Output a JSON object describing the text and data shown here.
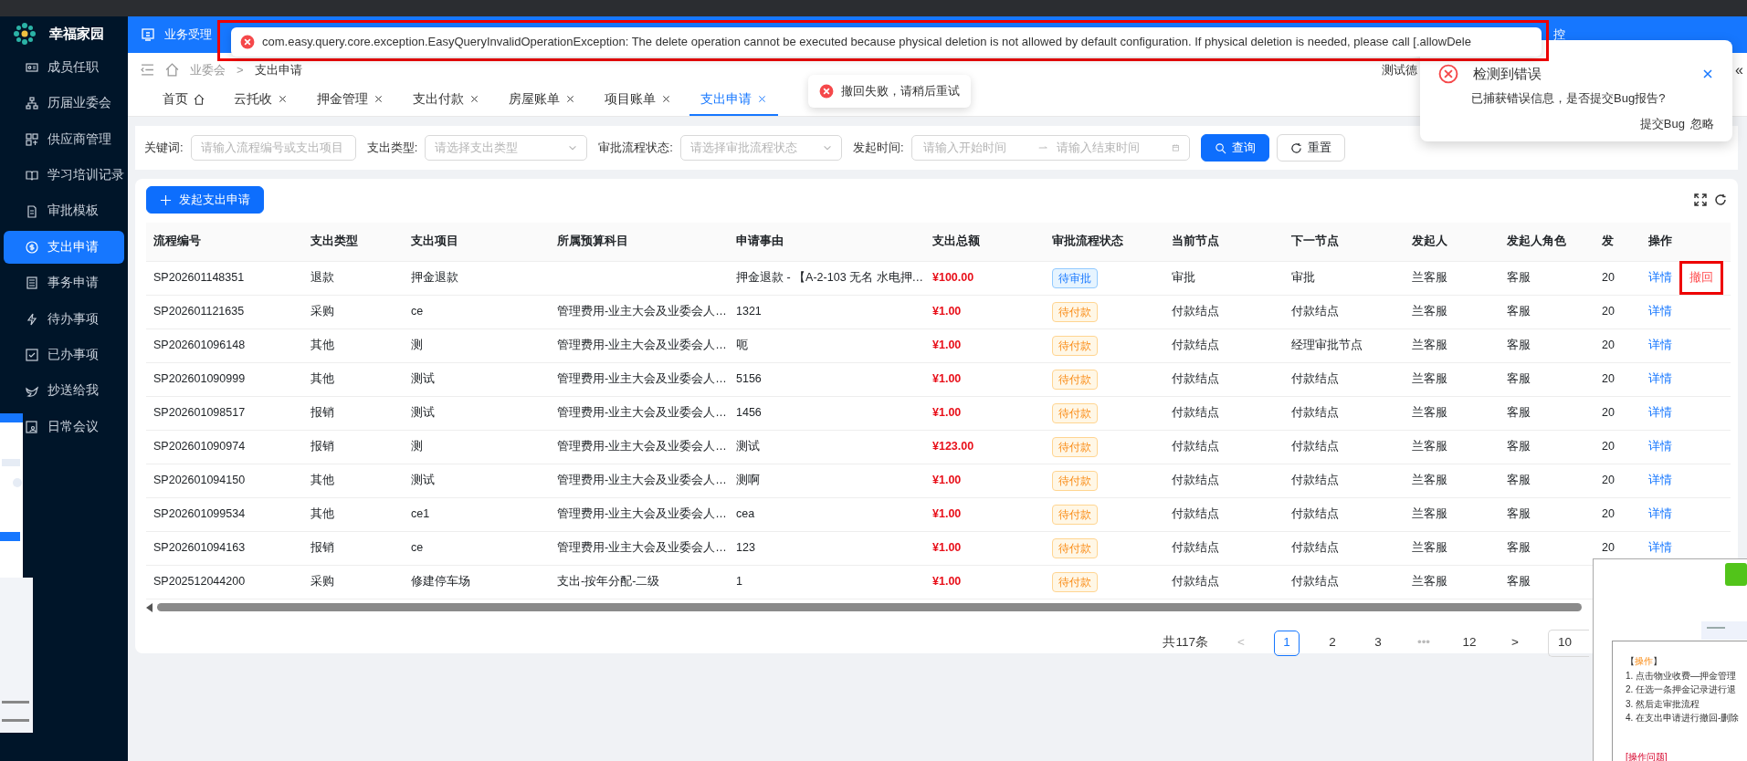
{
  "app": {
    "name": "幸福家园"
  },
  "header": {
    "module": "业务受理",
    "right_text": "控"
  },
  "sidebar": {
    "items": [
      {
        "label": "成员任职",
        "selected": false
      },
      {
        "label": "历届业委会",
        "selected": false
      },
      {
        "label": "供应商管理",
        "selected": false
      },
      {
        "label": "学习培训记录",
        "selected": false
      },
      {
        "label": "审批模板",
        "selected": false
      },
      {
        "label": "支出申请",
        "selected": true
      },
      {
        "label": "事务申请",
        "selected": false
      },
      {
        "label": "待办事项",
        "selected": false
      },
      {
        "label": "已办事项",
        "selected": false
      },
      {
        "label": "抄送给我",
        "selected": false
      },
      {
        "label": "日常会议",
        "selected": false
      }
    ]
  },
  "breadcrumb": {
    "items": [
      "业委会",
      "支出申请"
    ],
    "separator": ">",
    "user_text": "测试德",
    "collapse_glyph": "«"
  },
  "tabs": [
    {
      "label": "首页",
      "kind": "home",
      "selected": false
    },
    {
      "label": "云托收",
      "kind": "closable",
      "selected": false
    },
    {
      "label": "押金管理",
      "kind": "closable",
      "selected": false
    },
    {
      "label": "支出付款",
      "kind": "closable",
      "selected": false
    },
    {
      "label": "房屋账单",
      "kind": "closable",
      "selected": false
    },
    {
      "label": "项目账单",
      "kind": "closable",
      "selected": false
    },
    {
      "label": "支出申请",
      "kind": "closable",
      "selected": true
    }
  ],
  "filters": {
    "keyword": {
      "label": "关键词:",
      "placeholder": "请输入流程编号或支出项目"
    },
    "type": {
      "label": "支出类型:",
      "placeholder": "请选择支出类型"
    },
    "status": {
      "label": "审批流程状态:",
      "placeholder": "请选择审批流程状态"
    },
    "time": {
      "label": "发起时间:",
      "start_placeholder": "请输入开始时间",
      "end_placeholder": "请输入结束时间"
    },
    "search_button": "查询",
    "reset_button": "重置"
  },
  "add_button": "发起支出申请",
  "table": {
    "columns": [
      "流程编号",
      "支出类型",
      "支出项目",
      "所属预算科目",
      "申请事由",
      "支出总额",
      "审批流程状态",
      "当前节点",
      "下一节点",
      "发起人",
      "发起人角色",
      "发",
      "操作"
    ],
    "rows": [
      {
        "number": "SP202601148351",
        "type": "退款",
        "item": "押金退款",
        "reason": "押金退款 - 【A-2-103 无名 水电押…",
        "amount": "¥100.00",
        "status": {
          "text": "待审批",
          "kind": "review"
        },
        "current_node": "审批",
        "next_node": "审批",
        "initiator": "兰客服",
        "role": "客服",
        "column_12": "20",
        "actions": [
          {
            "text": "详情",
            "kind": "link",
            "highlighted": false
          },
          {
            "text": "撤回",
            "kind": "danger",
            "highlighted": true
          }
        ]
      },
      {
        "number": "SP202601121635",
        "type": "采购",
        "item": "ce",
        "budget": "管理费用-业主大会及业委会人…",
        "reason": "1321",
        "amount": "¥1.00",
        "status": {
          "text": "待付款",
          "kind": "payment"
        },
        "current_node": "付款结点",
        "next_node": "付款结点",
        "initiator": "兰客服",
        "role": "客服",
        "column_12": "20",
        "actions": [
          {
            "text": "详情",
            "kind": "link",
            "highlighted": false
          }
        ]
      },
      {
        "number": "SP202601096148",
        "type": "其他",
        "item": "测",
        "budget": "管理费用-业主大会及业委会人…",
        "reason": "呃",
        "amount": "¥1.00",
        "status": {
          "text": "待付款",
          "kind": "payment"
        },
        "current_node": "付款结点",
        "next_node": "经理审批节点",
        "initiator": "兰客服",
        "role": "客服",
        "column_12": "20",
        "actions": [
          {
            "text": "详情",
            "kind": "link",
            "highlighted": false
          }
        ]
      },
      {
        "number": "SP202601090999",
        "type": "其他",
        "item": "测试",
        "budget": "管理费用-业主大会及业委会人…",
        "reason": "5156",
        "amount": "¥1.00",
        "status": {
          "text": "待付款",
          "kind": "payment"
        },
        "current_node": "付款结点",
        "next_node": "付款结点",
        "initiator": "兰客服",
        "role": "客服",
        "column_12": "20",
        "actions": [
          {
            "text": "详情",
            "kind": "link",
            "highlighted": false
          }
        ]
      },
      {
        "number": "SP202601098517",
        "type": "报销",
        "item": "测试",
        "budget": "管理费用-业主大会及业委会人…",
        "reason": "1456",
        "amount": "¥1.00",
        "status": {
          "text": "待付款",
          "kind": "payment"
        },
        "current_node": "付款结点",
        "next_node": "付款结点",
        "initiator": "兰客服",
        "role": "客服",
        "column_12": "20",
        "actions": [
          {
            "text": "详情",
            "kind": "link",
            "highlighted": false
          }
        ]
      },
      {
        "number": "SP202601090974",
        "type": "报销",
        "item": "测",
        "budget": "管理费用-业主大会及业委会人…",
        "reason": "测试",
        "amount": "¥123.00",
        "status": {
          "text": "待付款",
          "kind": "payment"
        },
        "current_node": "付款结点",
        "next_node": "付款结点",
        "initiator": "兰客服",
        "role": "客服",
        "column_12": "20",
        "actions": [
          {
            "text": "详情",
            "kind": "link",
            "highlighted": false
          }
        ]
      },
      {
        "number": "SP202601094150",
        "type": "其他",
        "item": "测试",
        "budget": "管理费用-业主大会及业委会人…",
        "reason": "测啊",
        "amount": "¥1.00",
        "status": {
          "text": "待付款",
          "kind": "payment"
        },
        "current_node": "付款结点",
        "next_node": "付款结点",
        "initiator": "兰客服",
        "role": "客服",
        "column_12": "20",
        "actions": [
          {
            "text": "详情",
            "kind": "link",
            "highlighted": false
          }
        ]
      },
      {
        "number": "SP202601099534",
        "type": "其他",
        "item": "ce1",
        "budget": "管理费用-业主大会及业委会人…",
        "reason": "cea",
        "amount": "¥1.00",
        "status": {
          "text": "待付款",
          "kind": "payment"
        },
        "current_node": "付款结点",
        "next_node": "付款结点",
        "initiator": "兰客服",
        "role": "客服",
        "column_12": "20",
        "actions": [
          {
            "text": "详情",
            "kind": "link",
            "highlighted": false
          }
        ]
      },
      {
        "number": "SP202601094163",
        "type": "报销",
        "item": "ce",
        "budget": "管理费用-业主大会及业委会人…",
        "reason": "123",
        "amount": "¥1.00",
        "status": {
          "text": "待付款",
          "kind": "payment"
        },
        "current_node": "付款结点",
        "next_node": "付款结点",
        "initiator": "兰客服",
        "role": "客服",
        "column_12": "20",
        "actions": [
          {
            "text": "详情",
            "kind": "link",
            "highlighted": false
          }
        ]
      },
      {
        "number": "SP202512044200",
        "type": "采购",
        "item": "修建停车场",
        "budget": "支出-按年分配-二级",
        "reason": "1",
        "amount": "¥1.00",
        "status": {
          "text": "待付款",
          "kind": "payment"
        },
        "current_node": "付款结点",
        "next_node": "付款结点",
        "initiator": "兰客服",
        "role": "客服"
      }
    ]
  },
  "pagination": {
    "total": "共117条",
    "prev": "<",
    "next": ">",
    "ellipsis": "•••",
    "pages": [
      {
        "label": "1",
        "selected": true
      },
      {
        "label": "2",
        "selected": false
      },
      {
        "label": "3",
        "selected": false
      },
      {
        "label": "12",
        "selected": false
      }
    ],
    "page_size": "10"
  },
  "error_toast": {
    "text": "com.easy.query.core.exception.EasyQueryInvalidOperationException: The delete operation cannot be executed because physical deletion is not allowed by default configuration. If physical deletion is needed, please call [.allowDele",
    "highlighted": true
  },
  "message_toast": {
    "text": "撤回失败，请稍后重试"
  },
  "notification": {
    "title": "检测到错误",
    "body": "已捕获错误信息，是否提交Bug报告?",
    "actions": [
      "提交Bug",
      "忽略"
    ]
  },
  "note_panel": {
    "heading": "【**操作**】",
    "steps": [
      "1. 点击物业收费—押金管理",
      "2. 任选一条押金记录进行退",
      "3. 然后走审批流程",
      "4. 在支出申请进行撤回-删除"
    ],
    "problem": "[操作问题]"
  }
}
